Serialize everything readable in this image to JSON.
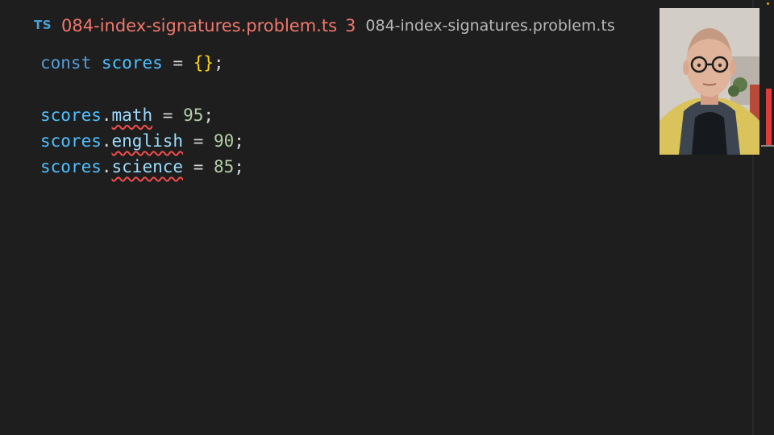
{
  "tab": {
    "language_badge": "TS",
    "filename": "084-index-signatures.problem.ts",
    "problem_count": "3",
    "breadcrumb": "084-index-signatures.problem.ts"
  },
  "editor": {
    "line1": {
      "keyword": "const",
      "name": "scores",
      "op": "=",
      "braces": "{}",
      "end": ";"
    },
    "line2": {
      "obj": "scores",
      "dot": ".",
      "prop": "math",
      "op": "=",
      "value": "95",
      "end": ";"
    },
    "line3": {
      "obj": "scores",
      "dot": ".",
      "prop": "english",
      "op": "=",
      "value": "90",
      "end": ";"
    },
    "line4": {
      "obj": "scores",
      "dot": ".",
      "prop": "science",
      "op": "=",
      "value": "85",
      "end": ";"
    }
  },
  "colors": {
    "background": "#1e1e1e",
    "error": "#f0776c",
    "keyword": "#569cd6",
    "variable": "#4fc1ff",
    "property": "#9cdcfe",
    "number": "#b5cea8",
    "brace": "#ffd700"
  }
}
